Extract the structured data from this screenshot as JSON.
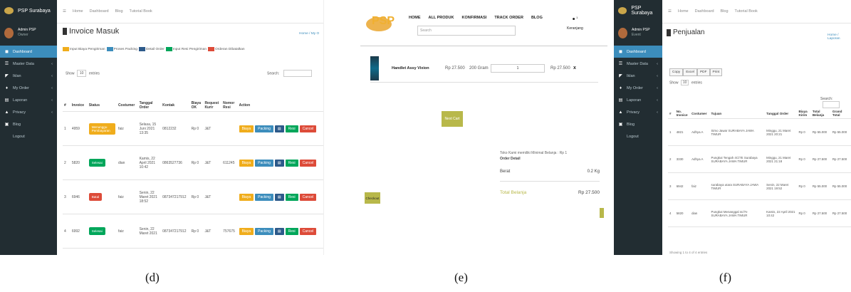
{
  "captions": [
    "(d)",
    "(e)",
    "(f)"
  ],
  "admin": {
    "brand": "PSP Surabaya",
    "user": "Admin PSP",
    "role": "Owner",
    "role_f": "Event",
    "menu": [
      "Dashboard",
      "Master Data",
      "Iklan",
      "My Order",
      "Laporan",
      "Privacy",
      "Blog",
      "Logout"
    ],
    "menu_f": [
      "Dashboard",
      "Master Data",
      "Iklan",
      "My Order",
      "Laporan",
      "Privacy",
      "Blog",
      "Logout"
    ],
    "topnav": [
      "Home",
      "Dashboard",
      "Blog",
      "Tutorial Book"
    ],
    "show": "Show",
    "entries": "entries",
    "show_n": "10",
    "search": "Search:"
  },
  "invoice": {
    "title": "Invoice Masuk",
    "breadcrumb": "Home / My O",
    "legend": [
      {
        "color": "#f0ad1c",
        "label": "Input Biaya Pengiriman"
      },
      {
        "color": "#3c8dbc",
        "label": "Proses Packing"
      },
      {
        "color": "#2d5a8a",
        "label": "Detail Order"
      },
      {
        "color": "#00a65a",
        "label": "Input Resi Pengiriman"
      },
      {
        "color": "#dd4b39",
        "label": "Orderan Dibatalkan"
      }
    ],
    "headers": [
      "#",
      "Invoice",
      "Status",
      "Costumer",
      "Tanggal Order",
      "Kontak",
      "Biaya OK",
      "Request Kurir",
      "Nomor Resi",
      "Action"
    ],
    "rows": [
      {
        "n": "1",
        "inv": "4959",
        "status": "Menunggu Pembayaran",
        "sc": "#f0ad1c",
        "cust": "faiz",
        "date": "Selasa, 15 Juni 2021 13:35",
        "kontak": "0812232",
        "biaya": "Rp 0",
        "kurir": "J&T",
        "resi": ""
      },
      {
        "n": "2",
        "inv": "5820",
        "status": "Selesai",
        "sc": "#00a65a",
        "cust": "dian",
        "date": "Kamis, 22 April 2021 10:42",
        "kontak": "0863527736",
        "biaya": "Rp 0",
        "kurir": "J&T",
        "resi": "611245"
      },
      {
        "n": "3",
        "inv": "6946",
        "status": "Batal",
        "sc": "#dd4b39",
        "cust": "faiz",
        "date": "Senin, 22 Maret 2021 18:52",
        "kontak": "087347217912",
        "biaya": "Rp 0",
        "kurir": "J&T",
        "resi": ""
      },
      {
        "n": "4",
        "inv": "6992",
        "status": "Selesai",
        "sc": "#00a65a",
        "cust": "faiz",
        "date": "Senin, 22 Maret 2021",
        "kontak": "087347217912",
        "biaya": "Rp 0",
        "kurir": "J&T",
        "resi": "757675"
      }
    ],
    "actions": [
      "Biaya",
      "Packing",
      "",
      "Resi",
      "Cancel"
    ]
  },
  "cart": {
    "logo": "PSP",
    "nav": [
      "HOME",
      "ALL PRODUK",
      "KONFIRMASI",
      "TRACK ORDER",
      "BLOG"
    ],
    "search_placeholder": "Search",
    "cart_label": "Keranjang",
    "cart_count": "1",
    "item": {
      "name": "Handlet Assy Vixion",
      "price": "Rp 27.500",
      "weight": "200 Gram",
      "qty": "1",
      "subtotal": "Rp 27.500",
      "remove": "x"
    },
    "next": "Next Cart",
    "note": "Toko Kami memiliki Minimal Belanja : Rp 1",
    "detail": "Order Detail",
    "berat_label": "Berat",
    "berat": "0.2 Kg",
    "total_label": "Total Belanja",
    "total": "Rp 27.500",
    "checkout": "Checkout"
  },
  "penjualan": {
    "title": "Penjualan",
    "breadcrumb": "Home / Laporan",
    "exports": [
      "Copy",
      "Excel",
      "PDF",
      "Print"
    ],
    "headers": [
      "#",
      "No. Invoice",
      "Costumer",
      "Tujuan",
      "Tanggal Order",
      "Biaya Kirim",
      "Total Belanja",
      "Grand Total"
    ],
    "rows": [
      {
        "n": "1",
        "inv": "4821",
        "cust": "Adhya A",
        "tujuan": "Simo Jawar SURABAYA JAWA TIMUR",
        "date": "Minggu, 21 Maret 2021 20:21",
        "kirim": "Rp 0",
        "total": "Rp 55.000",
        "grand": "Rp 55.000"
      },
      {
        "n": "2",
        "inv": "3330",
        "cust": "Adhya A",
        "tujuan": "Pungkut Tengah 4C/7E Surabaya SURABAYA JAWA TIMUR",
        "date": "Minggu, 21 Maret 2021 21:18",
        "kirim": "Rp 0",
        "total": "Rp 27.500",
        "grand": "Rp 27.500"
      },
      {
        "n": "3",
        "inv": "6942",
        "cust": "faiz",
        "tujuan": "surabaya utara SURABAYA JAWA TIMUR",
        "date": "Senin, 22 Maret 2021 19:52",
        "kirim": "Rp 0",
        "total": "Rp 55.000",
        "grand": "Rp 55.000"
      },
      {
        "n": "4",
        "inv": "5820",
        "cust": "dian",
        "tujuan": "Pungkut Menanggal 4c/7e SURABAYA JAWA TIMUR",
        "date": "Kamis, 22 April 2021 10:42",
        "kirim": "Rp 0",
        "total": "Rp 27.500",
        "grand": "Rp 27.500"
      }
    ],
    "footer": "Showing 1 to 4 of 4 entries"
  }
}
